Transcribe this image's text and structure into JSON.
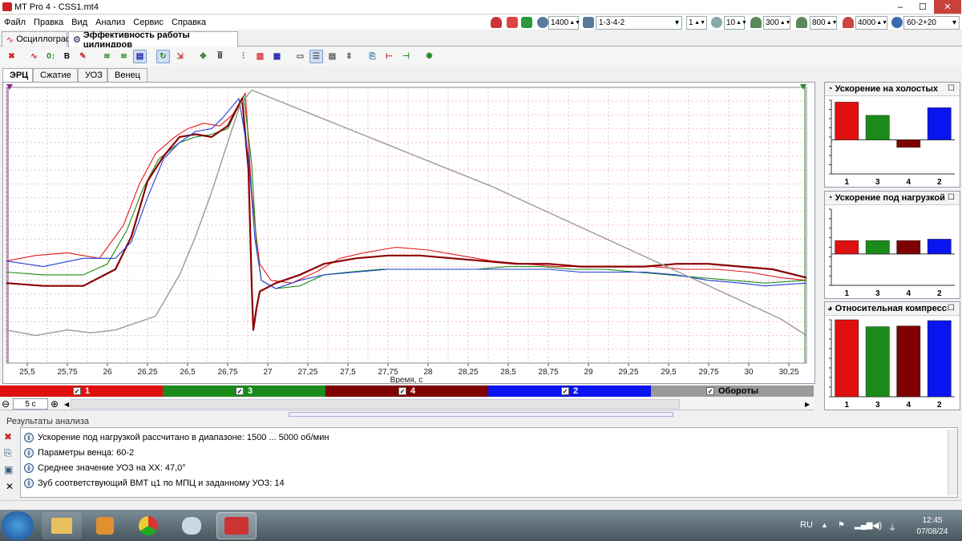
{
  "window": {
    "title": "MT Pro 4 - CSS1.mt4",
    "min": "–",
    "max": "☐",
    "close": "✕"
  },
  "menu": [
    "Файл",
    "Правка",
    "Вид",
    "Анализ",
    "Сервис",
    "Справка"
  ],
  "top_controls": {
    "rpm": "1400",
    "firing_order": "1-3-4-2",
    "count": "1",
    "samples": "10",
    "v300": "300",
    "v800": "800",
    "v4000": "4000",
    "wheel": "60-2+20"
  },
  "main_tabs": [
    {
      "label": "Осциллограф",
      "active": false
    },
    {
      "label": "Эффективность работы цилиндров",
      "active": true
    }
  ],
  "sub_tabs": [
    {
      "label": "ЭРЦ",
      "active": true
    },
    {
      "label": "Сжатие",
      "active": false
    },
    {
      "label": "УОЗ",
      "active": false
    },
    {
      "label": "Венец",
      "active": false
    }
  ],
  "toolbar_text": {
    "b": "B",
    "i": "ĨĪ"
  },
  "chart_data": {
    "type": "line",
    "xlabel": "Время, с",
    "xlim": [
      25.37,
      30.36
    ],
    "x_ticks": [
      "25,5",
      "25,75",
      "26",
      "26,25",
      "26,5",
      "26,75",
      "27",
      "27,25",
      "27,5",
      "27,75",
      "28",
      "28,25",
      "28,5",
      "28,75",
      "29",
      "29,25",
      "29,5",
      "29,75",
      "30",
      "30,25"
    ],
    "x_tick_values": [
      25.5,
      25.75,
      26,
      26.25,
      26.5,
      26.75,
      27,
      27.25,
      27.5,
      27.75,
      28,
      28.25,
      28.5,
      28.75,
      29,
      29.25,
      29.5,
      29.75,
      30,
      30.25
    ],
    "ylim": [
      0,
      100
    ],
    "series": [
      {
        "name": "1",
        "color": "#e31a1c",
        "points": [
          [
            25.37,
            37
          ],
          [
            25.55,
            39
          ],
          [
            25.75,
            40
          ],
          [
            25.95,
            38
          ],
          [
            26.1,
            50
          ],
          [
            26.2,
            65
          ],
          [
            26.3,
            76
          ],
          [
            26.42,
            82
          ],
          [
            26.5,
            85
          ],
          [
            26.6,
            87
          ],
          [
            26.7,
            86
          ],
          [
            26.78,
            90
          ],
          [
            26.86,
            98
          ],
          [
            26.9,
            62
          ],
          [
            26.93,
            45
          ],
          [
            26.95,
            36
          ],
          [
            27.02,
            30
          ],
          [
            27.15,
            29
          ],
          [
            27.3,
            33
          ],
          [
            27.45,
            38
          ],
          [
            27.6,
            40
          ],
          [
            27.8,
            42
          ],
          [
            28.0,
            41
          ],
          [
            28.2,
            39
          ],
          [
            28.4,
            37
          ],
          [
            28.6,
            36
          ],
          [
            28.8,
            35
          ],
          [
            29.0,
            35
          ],
          [
            29.2,
            35
          ],
          [
            29.4,
            35
          ],
          [
            29.6,
            34
          ],
          [
            29.8,
            34
          ],
          [
            30.0,
            33
          ],
          [
            30.2,
            31
          ],
          [
            30.36,
            30
          ]
        ]
      },
      {
        "name": "3",
        "color": "#1a8a1a",
        "points": [
          [
            25.37,
            33
          ],
          [
            25.6,
            32
          ],
          [
            25.85,
            32
          ],
          [
            26.0,
            36
          ],
          [
            26.12,
            48
          ],
          [
            26.22,
            63
          ],
          [
            26.32,
            74
          ],
          [
            26.45,
            80
          ],
          [
            26.55,
            82
          ],
          [
            26.65,
            83
          ],
          [
            26.75,
            85
          ],
          [
            26.85,
            97
          ],
          [
            26.9,
            72
          ],
          [
            26.93,
            42
          ],
          [
            26.96,
            30
          ],
          [
            27.05,
            27
          ],
          [
            27.2,
            28
          ],
          [
            27.35,
            32
          ],
          [
            27.5,
            33
          ],
          [
            27.7,
            34
          ],
          [
            27.9,
            34
          ],
          [
            28.1,
            34
          ],
          [
            28.3,
            34
          ],
          [
            28.5,
            35
          ],
          [
            28.7,
            35
          ],
          [
            28.9,
            34
          ],
          [
            29.1,
            34
          ],
          [
            29.3,
            33
          ],
          [
            29.5,
            32
          ],
          [
            29.7,
            31
          ],
          [
            29.9,
            30
          ],
          [
            30.1,
            29
          ],
          [
            30.36,
            30
          ]
        ]
      },
      {
        "name": "4",
        "color": "#8b0000",
        "points": [
          [
            25.37,
            29
          ],
          [
            25.6,
            28
          ],
          [
            25.85,
            28
          ],
          [
            26.05,
            34
          ],
          [
            26.15,
            46
          ],
          [
            26.25,
            66
          ],
          [
            26.35,
            75
          ],
          [
            26.45,
            82
          ],
          [
            26.55,
            83
          ],
          [
            26.65,
            82
          ],
          [
            26.75,
            86
          ],
          [
            26.84,
            96
          ],
          [
            26.88,
            70
          ],
          [
            26.9,
            28
          ],
          [
            26.91,
            12
          ],
          [
            26.93,
            20
          ],
          [
            26.95,
            26
          ],
          [
            27.05,
            29
          ],
          [
            27.2,
            32
          ],
          [
            27.35,
            36
          ],
          [
            27.55,
            38
          ],
          [
            27.75,
            39
          ],
          [
            27.95,
            39
          ],
          [
            28.15,
            38
          ],
          [
            28.35,
            37
          ],
          [
            28.55,
            36
          ],
          [
            28.75,
            36
          ],
          [
            28.95,
            35
          ],
          [
            29.15,
            35
          ],
          [
            29.35,
            35
          ],
          [
            29.55,
            36
          ],
          [
            29.75,
            36
          ],
          [
            29.95,
            35
          ],
          [
            30.15,
            34
          ],
          [
            30.36,
            31
          ]
        ]
      },
      {
        "name": "2",
        "color": "#1f3fd8",
        "points": [
          [
            25.37,
            37
          ],
          [
            25.6,
            35
          ],
          [
            25.85,
            38
          ],
          [
            26.05,
            38
          ],
          [
            26.15,
            44
          ],
          [
            26.25,
            60
          ],
          [
            26.35,
            74
          ],
          [
            26.45,
            80
          ],
          [
            26.55,
            84
          ],
          [
            26.65,
            85
          ],
          [
            26.72,
            89
          ],
          [
            26.82,
            96
          ],
          [
            26.88,
            75
          ],
          [
            26.92,
            45
          ],
          [
            26.96,
            30
          ],
          [
            27.05,
            27
          ],
          [
            27.2,
            30
          ],
          [
            27.35,
            32
          ],
          [
            27.55,
            33
          ],
          [
            27.75,
            34
          ],
          [
            27.95,
            34
          ],
          [
            28.15,
            34
          ],
          [
            28.35,
            34
          ],
          [
            28.55,
            34
          ],
          [
            28.75,
            34
          ],
          [
            28.95,
            33
          ],
          [
            29.15,
            33
          ],
          [
            29.35,
            33
          ],
          [
            29.55,
            32
          ],
          [
            29.75,
            30
          ],
          [
            29.95,
            29
          ],
          [
            30.1,
            28
          ],
          [
            30.36,
            29
          ]
        ]
      },
      {
        "name": "Обороты",
        "color": "#9a9a9a",
        "points": [
          [
            25.37,
            12
          ],
          [
            25.55,
            10
          ],
          [
            25.75,
            12
          ],
          [
            25.9,
            11
          ],
          [
            26.05,
            12
          ],
          [
            26.15,
            14
          ],
          [
            26.3,
            17
          ],
          [
            26.45,
            32
          ],
          [
            26.55,
            46
          ],
          [
            26.65,
            62
          ],
          [
            26.75,
            80
          ],
          [
            26.83,
            94
          ],
          [
            26.9,
            99
          ],
          [
            27.2,
            92
          ],
          [
            27.5,
            85
          ],
          [
            27.8,
            78
          ],
          [
            28.1,
            71
          ],
          [
            28.4,
            64
          ],
          [
            28.7,
            56
          ],
          [
            29.0,
            48
          ],
          [
            29.3,
            40
          ],
          [
            29.6,
            32
          ],
          [
            29.9,
            24
          ],
          [
            30.2,
            16
          ],
          [
            30.36,
            10
          ]
        ]
      }
    ]
  },
  "legend": [
    {
      "label": "1",
      "color": "#e01010"
    },
    {
      "label": "3",
      "color": "#1a8a1a"
    },
    {
      "label": "4",
      "color": "#7f0000"
    },
    {
      "label": "2",
      "color": "#0a14f0"
    },
    {
      "label": "Обороты",
      "color": "#9a9a9a"
    }
  ],
  "zoom": {
    "value": "5 с",
    "minus": "⊖",
    "plus": "⊕"
  },
  "side_charts": [
    {
      "title": "Ускорение на холостых",
      "categories": [
        "1",
        "3",
        "4",
        "2"
      ],
      "values": [
        1.0,
        0.65,
        -0.2,
        0.85
      ],
      "ylim": [
        -0.9,
        1.05
      ],
      "colors": [
        "#e01010",
        "#1a8a1a",
        "#7f0000",
        "#0a14f0"
      ]
    },
    {
      "title": "Ускорение под нагрузкой",
      "categories": [
        "1",
        "3",
        "4",
        "2"
      ],
      "values": [
        0.3,
        0.3,
        0.3,
        0.33
      ],
      "ylim": [
        -0.7,
        1.0
      ],
      "colors": [
        "#e01010",
        "#1a8a1a",
        "#7f0000",
        "#0a14f0"
      ]
    },
    {
      "title": "Относительная компрессия",
      "categories": [
        "1",
        "3",
        "4",
        "2"
      ],
      "values": [
        1.0,
        0.91,
        0.92,
        0.99
      ],
      "ylim": [
        0,
        1.0
      ],
      "colors": [
        "#e01010",
        "#1a8a1a",
        "#7f0000",
        "#0a14f0"
      ]
    }
  ],
  "results": {
    "header": "Результаты анализа",
    "lines": [
      "Ускорение под нагрузкой рассчитано в диапазоне: 1500 ... 5000 об/мин",
      "Параметры венца: 60-2",
      "Среднее значение УОЗ на ХХ: 47,0°",
      "Зуб соответствующий ВМТ ц1 по МПЦ и заданному УОЗ: 14"
    ]
  },
  "tray": {
    "lang": "RU",
    "time": "12:45",
    "date": "07/08/24"
  }
}
